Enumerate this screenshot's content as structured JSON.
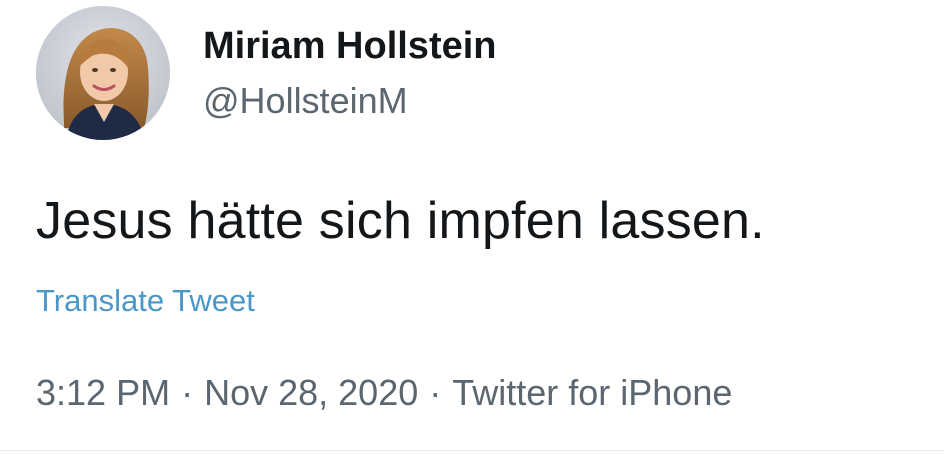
{
  "tweet": {
    "author": {
      "display_name": "Miriam Hollstein",
      "handle": "@HollsteinM",
      "avatar": "profile-photo"
    },
    "text": "Jesus hätte sich impfen lassen.",
    "translate_label": "Translate Tweet",
    "meta": {
      "time": "3:12 PM",
      "separator": "·",
      "date": "Nov 28, 2020",
      "source": "Twitter for iPhone"
    }
  },
  "colors": {
    "text_primary": "#14171a",
    "text_secondary": "#5b6670",
    "link": "#4a97c9",
    "background": "#ffffff"
  }
}
